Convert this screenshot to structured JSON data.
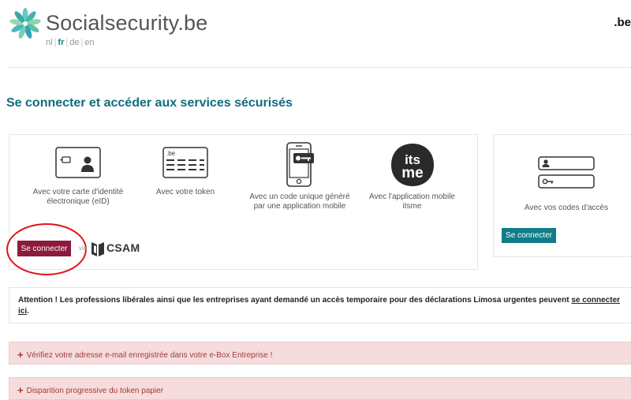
{
  "header": {
    "brand": "Socialsecurity.be",
    "languages": [
      {
        "code": "nl",
        "active": false
      },
      {
        "code": "fr",
        "active": true
      },
      {
        "code": "de",
        "active": false
      },
      {
        "code": "en",
        "active": false
      }
    ],
    "be_logo": ".be"
  },
  "page_title": "Se connecter et accéder aux services sécurisés",
  "methods": [
    {
      "icon": "eid-card-icon",
      "label": "Avec votre carte d'identité électronique (eID)"
    },
    {
      "icon": "token-card-icon",
      "label": "Avec votre token"
    },
    {
      "icon": "mobile-code-icon",
      "label": "Avec un code unique généré par une application mobile"
    },
    {
      "icon": "itsme-icon",
      "label": "Avec l'application mobile itsme",
      "logo_text_top": "its",
      "logo_text_bottom": "me"
    }
  ],
  "connect_button": "Se connecter",
  "via_text": "via",
  "csam": "CSAM",
  "access_codes": {
    "icon": "access-codes-icon",
    "label": "Avec vos codes d'accès",
    "button": "Se connecter"
  },
  "notice": {
    "text": "Attention ! Les professions libérales ainsi que les entreprises ayant demandé un accès temporaire pour des déclarations Limosa urgentes peuvent ",
    "link": "se connecter ici",
    "end": "."
  },
  "alerts": [
    {
      "text": "Vérifiez votre adresse e-mail enregistrée dans votre e-Box Entreprise !"
    },
    {
      "text": "Disparition progressive du token papier"
    }
  ],
  "colors": {
    "accent": "#0d6e7d",
    "eid_button": "#8c1a3c",
    "codes_button": "#107c8a",
    "alert_bg": "#f6dcdc",
    "annotation_circle": "#e0161b"
  }
}
